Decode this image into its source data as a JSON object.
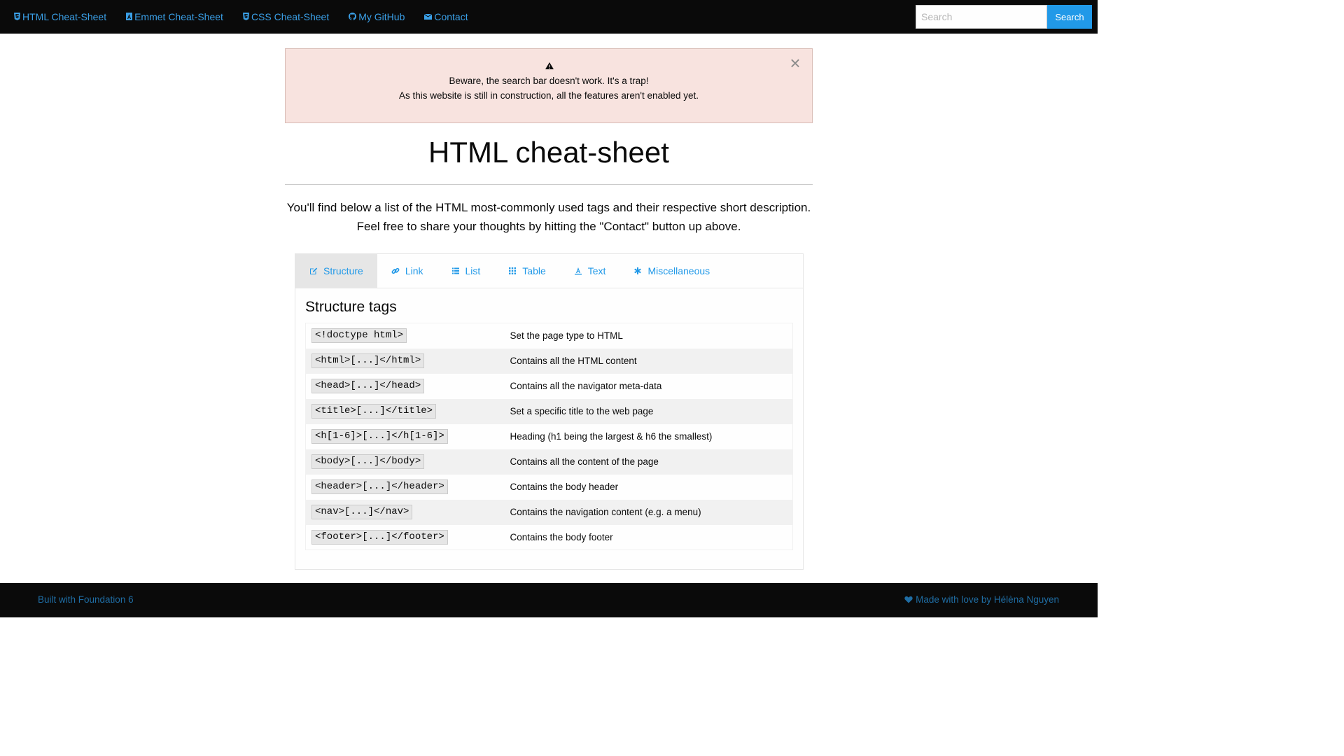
{
  "nav": {
    "items": [
      {
        "label": "HTML Cheat-Sheet",
        "icon": "html5-icon"
      },
      {
        "label": "Emmet Cheat-Sheet",
        "icon": "emmet-icon"
      },
      {
        "label": "CSS Cheat-Sheet",
        "icon": "css3-icon"
      },
      {
        "label": "My GitHub",
        "icon": "github-icon"
      },
      {
        "label": "Contact",
        "icon": "envelope-icon"
      }
    ],
    "search_placeholder": "Search",
    "search_button": "Search"
  },
  "alert": {
    "line1": "Beware, the search bar doesn't work. It's a trap!",
    "line2": "As this website is still in construction, all the features aren't enabled yet.",
    "close": "×"
  },
  "page": {
    "title": "HTML cheat-sheet",
    "intro_line1": "You'll find below a list of the HTML most-commonly used tags and their respective short description.",
    "intro_line2": "Feel free to share your thoughts by hitting the \"Contact\" button up above."
  },
  "tabs": [
    {
      "label": "Structure",
      "icon": "edit-icon",
      "active": true
    },
    {
      "label": "Link",
      "icon": "link-icon",
      "active": false
    },
    {
      "label": "List",
      "icon": "list-icon",
      "active": false
    },
    {
      "label": "Table",
      "icon": "grid-icon",
      "active": false
    },
    {
      "label": "Text",
      "icon": "text-icon",
      "active": false
    },
    {
      "label": "Miscellaneous",
      "icon": "asterisk-icon",
      "active": false
    }
  ],
  "panel": {
    "title": "Structure tags",
    "rows": [
      {
        "tag": "<!doctype html>",
        "desc": "Set the page type to HTML"
      },
      {
        "tag": "<html>[...]</html>",
        "desc": "Contains all the HTML content"
      },
      {
        "tag": "<head>[...]</head>",
        "desc": "Contains all the navigator meta-data"
      },
      {
        "tag": "<title>[...]</title>",
        "desc": "Set a specific title to the web page"
      },
      {
        "tag": "<h[1-6]>[...]</h[1-6]>",
        "desc": "Heading (h1 being the largest & h6 the smallest)"
      },
      {
        "tag": "<body>[...]</body>",
        "desc": "Contains all the content of the page"
      },
      {
        "tag": "<header>[...]</header>",
        "desc": "Contains the body header"
      },
      {
        "tag": "<nav>[...]</nav>",
        "desc": "Contains the navigation content (e.g. a menu)"
      },
      {
        "tag": "<footer>[...]</footer>",
        "desc": "Contains the body footer"
      }
    ]
  },
  "footer": {
    "left": "Built with Foundation 6",
    "right": "Made with love by Hélèna Nguyen"
  },
  "colors": {
    "link": "#2199e8",
    "topbar": "#0a0a0a",
    "alert_bg": "#f8e3df"
  }
}
